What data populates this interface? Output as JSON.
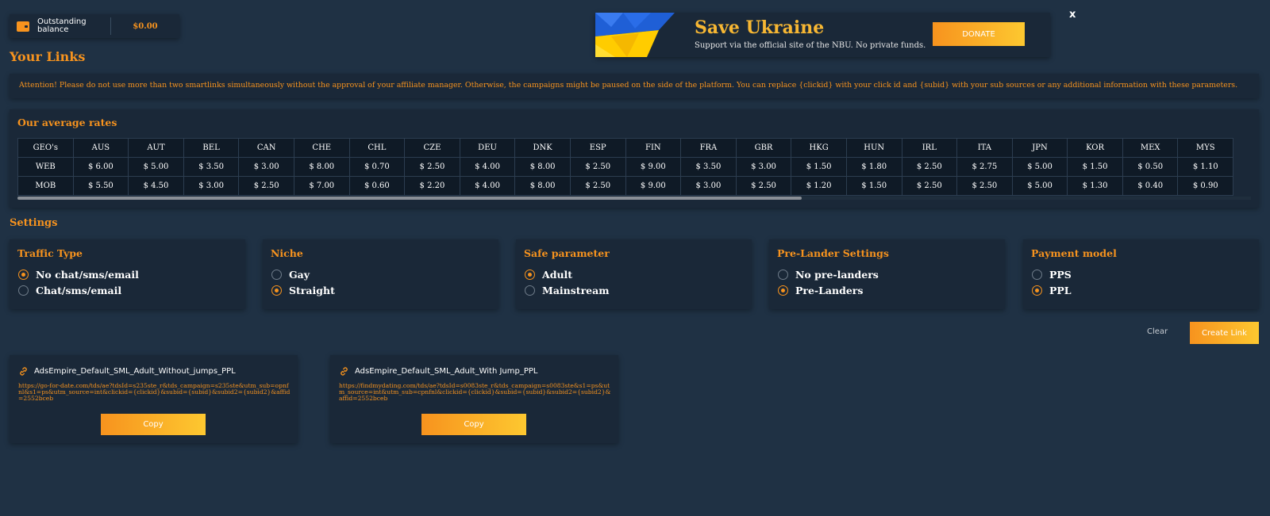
{
  "balance": {
    "label": "Outstanding balance",
    "amount": "$0.00"
  },
  "banner": {
    "title": "Save Ukraine",
    "subtitle": "Support via the official site of the NBU. No private funds.",
    "donate_label": "DONATE",
    "close_label": "x"
  },
  "page_title": "Your Links",
  "attention": "Attention! Please do not use more than two smartlinks simultaneously without the approval of your affiliate manager. Otherwise, the campaigns might be paused on the side of the platform. You can replace {clickid} with your click id and {subid} with your sub sources or any additional information with these parameters.",
  "rates": {
    "title": "Our average rates",
    "header": [
      "GEO's",
      "AUS",
      "AUT",
      "BEL",
      "CAN",
      "CHE",
      "CHL",
      "CZE",
      "DEU",
      "DNK",
      "ESP",
      "FIN",
      "FRA",
      "GBR",
      "HKG",
      "HUN",
      "IRL",
      "ITA",
      "JPN",
      "KOR",
      "MEX",
      "MYS"
    ],
    "web": [
      "WEB",
      "$ 6.00",
      "$ 5.00",
      "$ 3.50",
      "$ 3.00",
      "$ 8.00",
      "$ 0.70",
      "$ 2.50",
      "$ 4.00",
      "$ 8.00",
      "$ 2.50",
      "$ 9.00",
      "$ 3.50",
      "$ 3.00",
      "$ 1.50",
      "$ 1.80",
      "$ 2.50",
      "$ 2.75",
      "$ 5.00",
      "$ 1.50",
      "$ 0.50",
      "$ 1.10"
    ],
    "mob": [
      "MOB",
      "$ 5.50",
      "$ 4.50",
      "$ 3.00",
      "$ 2.50",
      "$ 7.00",
      "$ 0.60",
      "$ 2.20",
      "$ 4.00",
      "$ 8.00",
      "$ 2.50",
      "$ 9.00",
      "$ 3.00",
      "$ 2.50",
      "$ 1.20",
      "$ 1.50",
      "$ 2.50",
      "$ 2.50",
      "$ 5.00",
      "$ 1.30",
      "$ 0.40",
      "$ 0.90"
    ]
  },
  "settings": {
    "title": "Settings",
    "traffic": {
      "title": "Traffic Type",
      "options": [
        "No chat/sms/email",
        "Chat/sms/email"
      ]
    },
    "niche": {
      "title": "Niche",
      "options": [
        "Gay",
        "Straight"
      ]
    },
    "safe": {
      "title": "Safe parameter",
      "options": [
        "Adult",
        "Mainstream"
      ]
    },
    "prelander": {
      "title": "Pre-Lander Settings",
      "options": [
        "No pre-landers",
        "Pre-Landers"
      ]
    },
    "payment": {
      "title": "Payment model",
      "options": [
        "PPS",
        "PPL"
      ]
    }
  },
  "actions": {
    "clear_label": "Clear",
    "create_label": "Create Link"
  },
  "links": [
    {
      "name": "AdsEmpire_Default_SML_Adult_Without_jumps_PPL",
      "url": "https://go-for-date.com/tds/ae?tdsId=s235ste_r&tds_campaign=s235ste&utm_sub=opnfnl&s1=ps&utm_source=int&clickid={clickid}&subid={subid}&subid2={subid2}&affid=2552bceb",
      "copy_label": "Copy"
    },
    {
      "name": "AdsEmpire_Default_SML_Adult_With Jump_PPL",
      "url": "https://findmydating.com/tds/ae?tdsId=s0083ste_r&tds_campaign=s0083ste&s1=ps&utm_source=int&utm_sub=cpnfnl&clickid={clickid}&subid={subid}&subid2={subid2}&affid=2552bceb",
      "copy_label": "Copy"
    }
  ],
  "colors": {
    "accent": "#f7931e",
    "background": "#1f3144",
    "card": "#1a2838"
  }
}
